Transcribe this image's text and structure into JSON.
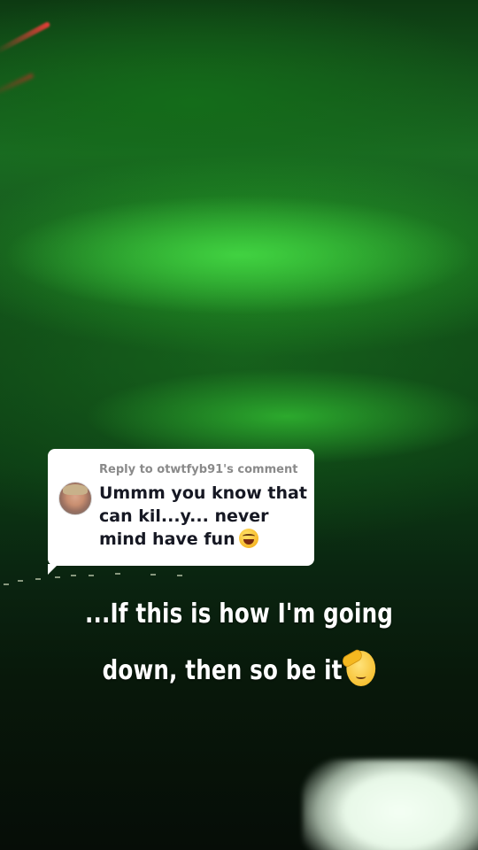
{
  "reply": {
    "header": "Reply to otwtfyb91's comment",
    "comment_text": "Ummm you know that can kil...y... never mind have fun",
    "emoji": "grinning-squinting-face",
    "avatar": "commenter-avatar"
  },
  "caption": {
    "line1": "...If this is how I'm going",
    "line2": "down, then so be it",
    "emoji": "saluting-face"
  }
}
